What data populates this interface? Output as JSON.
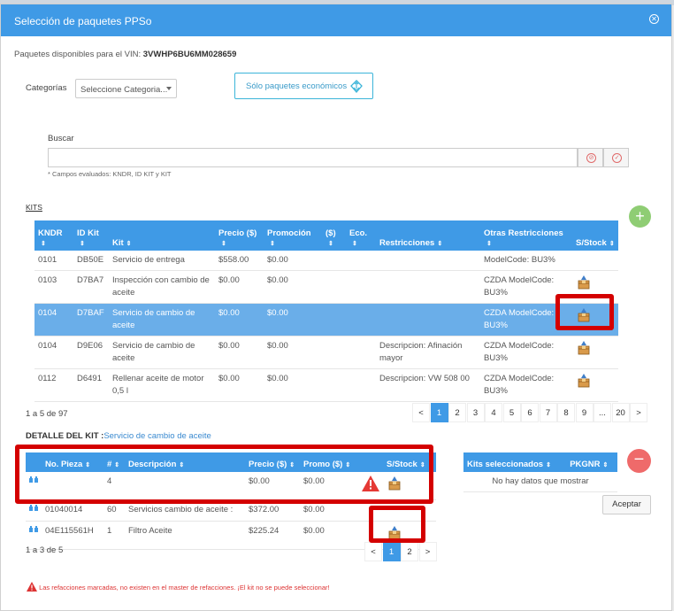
{
  "window": {
    "title": "Selección de paquetes PPSo",
    "close_icon": "close-circle-icon"
  },
  "vin": {
    "label": "Paquetes disponibles para el VIN:",
    "value": "3VWHP6BU6MM028659"
  },
  "categories": {
    "label": "Categorías",
    "placeholder": "Seleccione Categoria..."
  },
  "eco_button": {
    "label": "Sólo paquetes económicos",
    "icon": "economic-package-icon"
  },
  "search": {
    "label": "Buscar",
    "value": "",
    "hint": "* Campos evaluados: KNDR, ID KIT y KIT",
    "clear_icon": "clear-icon",
    "check_icon": "check-icon"
  },
  "kits": {
    "section_label": "KITS",
    "columns": [
      "KNDR",
      "ID Kit",
      "Kit",
      "Precio ($)",
      "Promoción",
      "($)",
      "Eco.",
      "Restricciones",
      "Otras Restricciones",
      "S/Stock"
    ],
    "rows": [
      {
        "kndr": "0101",
        "id": "DB50E",
        "kit": "Servicio de entrega",
        "precio": "$558.00",
        "promo": "$0.00",
        "restr": "",
        "otras": "ModelCode: BU3%",
        "stock": false
      },
      {
        "kndr": "0103",
        "id": "D7BA7",
        "kit": "Inspección con cambio de aceite",
        "precio": "$0.00",
        "promo": "$0.00",
        "restr": "",
        "otras": "CZDA ModelCode: BU3%",
        "stock": true
      },
      {
        "kndr": "0104",
        "id": "D7BAF",
        "kit": "Servicio de cambio de aceite",
        "precio": "$0.00",
        "promo": "$0.00",
        "restr": "",
        "otras": "CZDA ModelCode: BU3%",
        "stock": true
      },
      {
        "kndr": "0104",
        "id": "D9E06",
        "kit": "Servicio de cambio de aceite",
        "precio": "$0.00",
        "promo": "$0.00",
        "restr": "Descripcion: Afinación mayor",
        "otras": "CZDA ModelCode: BU3%",
        "stock": true
      },
      {
        "kndr": "0112",
        "id": "D6491",
        "kit": "Rellenar aceite de motor 0,5 l",
        "precio": "$0.00",
        "promo": "$0.00",
        "restr": "Descripcion: VW 508 00",
        "otras": "CZDA ModelCode: BU3%",
        "stock": true
      }
    ],
    "selected_index": 2,
    "count_text": "1 a 5 de 97",
    "pages": [
      "<",
      "1",
      "2",
      "3",
      "4",
      "5",
      "6",
      "7",
      "8",
      "9",
      "...",
      "20",
      ">"
    ],
    "active_page": "1"
  },
  "detalle": {
    "label": "DETALLE DEL KIT :",
    "kit_name": "Servicio de cambio de aceite",
    "columns": [
      "No. Pieza",
      "#",
      "Descripción",
      "Precio ($)",
      "Promo ($)",
      "S/Stock"
    ],
    "rows": [
      {
        "pieza": "",
        "n": "4",
        "desc": "",
        "precio": "$0.00",
        "promo": "$0.00",
        "warn": true,
        "stock": true
      },
      {
        "pieza": "01040014",
        "n": "60",
        "desc": "Servicios cambio de aceite :",
        "precio": "$372.00",
        "promo": "$0.00",
        "warn": false,
        "stock": false
      },
      {
        "pieza": "04E115561H",
        "n": "1",
        "desc": "Filtro Aceite",
        "precio": "$225.24",
        "promo": "$0.00",
        "warn": false,
        "stock": true
      }
    ],
    "count_text": "1 a 3 de 5",
    "pages": [
      "<",
      "1",
      "2",
      ">"
    ],
    "active_page": "1"
  },
  "selected_kits": {
    "columns": [
      "Kits seleccionados",
      "PKGNR"
    ],
    "empty_text": "No hay datos que mostrar"
  },
  "accept_label": "Aceptar",
  "warning_text": "Las refacciones marcadas, no existen en el master de refacciones. ¡El kit no se puede seleccionar!",
  "colors": {
    "header": "#3f9ae6",
    "selected_row": "#6aaee9",
    "highlight": "#d40000",
    "add": "#8fcd74",
    "remove": "#ef6a6a"
  }
}
